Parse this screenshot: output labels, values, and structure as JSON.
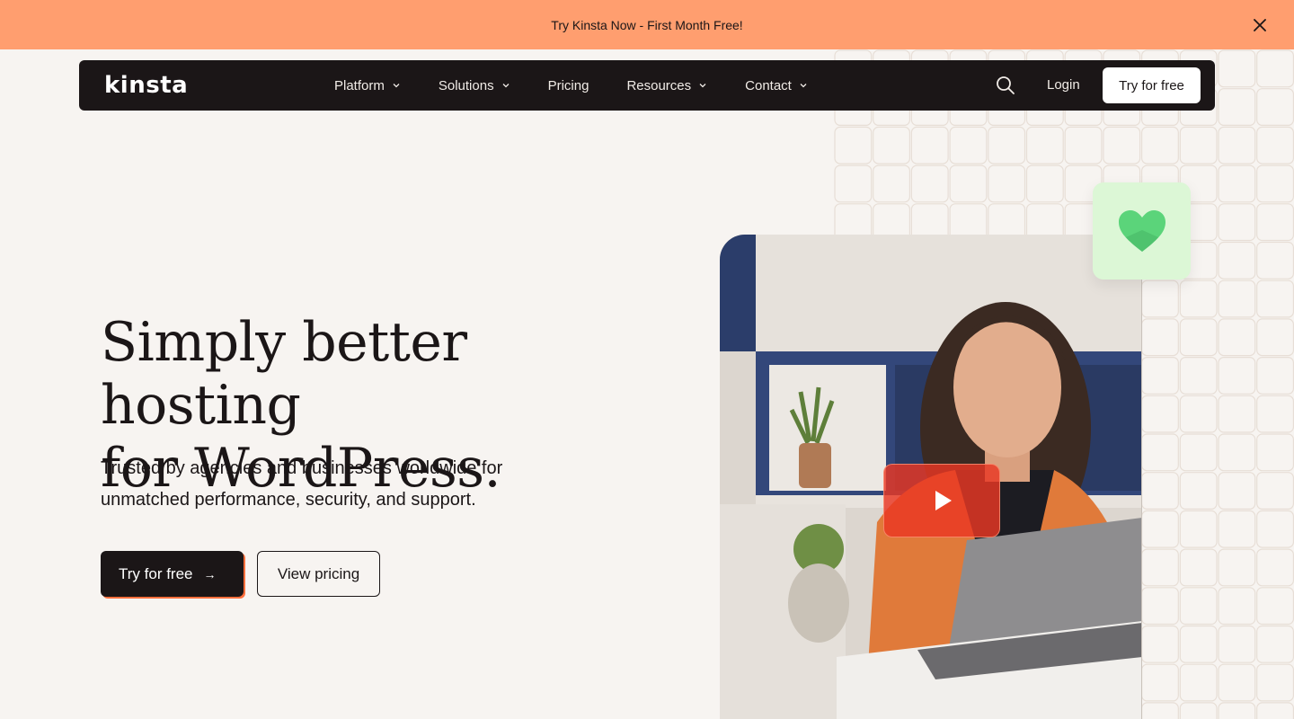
{
  "promo": {
    "text": "Try Kinsta Now - First Month Free!",
    "close_icon": "close-icon"
  },
  "nav": {
    "logo": "kinsta",
    "items": [
      {
        "label": "Platform",
        "has_dropdown": true
      },
      {
        "label": "Solutions",
        "has_dropdown": true
      },
      {
        "label": "Pricing",
        "has_dropdown": false
      },
      {
        "label": "Resources",
        "has_dropdown": true
      },
      {
        "label": "Contact",
        "has_dropdown": true
      }
    ],
    "search_icon": "search-icon",
    "login": "Login",
    "cta": "Try for free"
  },
  "hero": {
    "title_line1": "Simply better hosting",
    "title_line2": "for WordPress.",
    "subtitle_line1": "Trusted by agencies and businesses worldwide for",
    "subtitle_line2": "unmatched performance, security, and support.",
    "primary_cta": "Try for free",
    "primary_cta_icon": "arrow-right-icon",
    "secondary_cta": "View pricing"
  },
  "media": {
    "play_icon": "play-icon",
    "heart_icon": "heart-icon"
  },
  "colors": {
    "promo_bg": "#ff9e6f",
    "page_bg": "#f7f4f1",
    "nav_bg": "#1b1617",
    "accent": "#ff6f3d",
    "heart": "#5bd47a",
    "play_bg": "#e93723"
  }
}
